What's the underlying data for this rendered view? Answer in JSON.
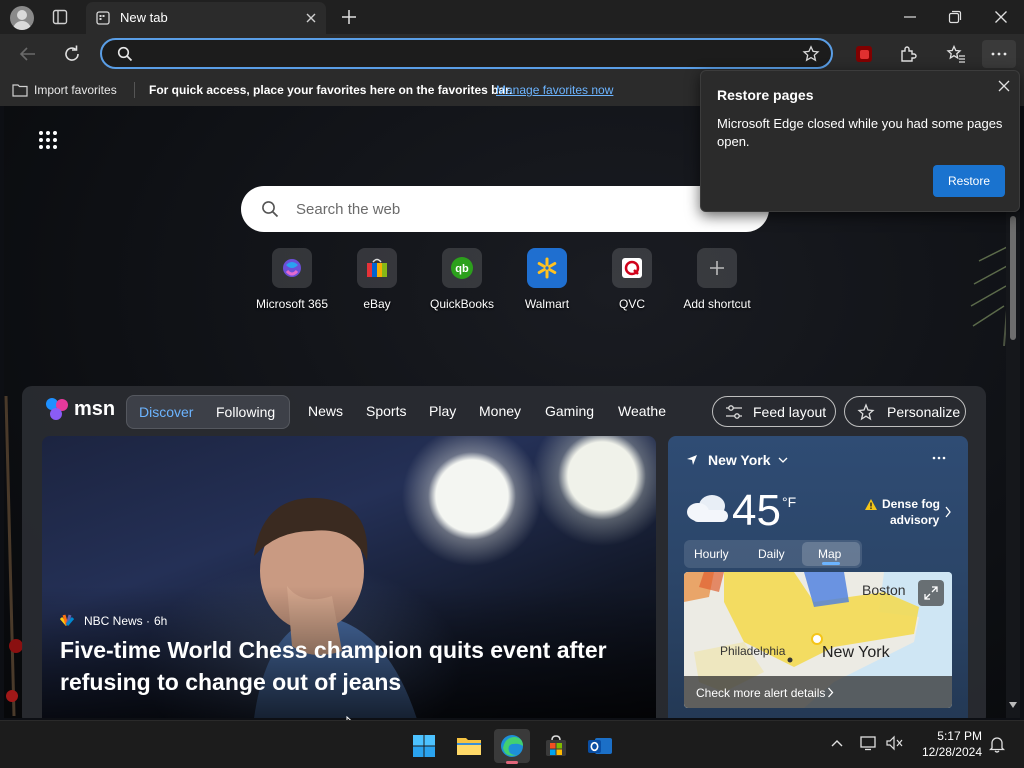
{
  "browser": {
    "tab_title": "New tab",
    "address_value": "",
    "favorites_bar": {
      "import_label": "Import favorites",
      "message": "For quick access, place your favorites here on the favorites bar.",
      "manage_link": "Manage favorites now"
    }
  },
  "newtab": {
    "search_placeholder": "Search the web",
    "shortcuts": [
      {
        "label": "Microsoft 365",
        "icon": "microsoft-365-icon"
      },
      {
        "label": "eBay",
        "icon": "ebay-icon"
      },
      {
        "label": "QuickBooks",
        "icon": "quickbooks-icon"
      },
      {
        "label": "Walmart",
        "icon": "walmart-icon"
      },
      {
        "label": "QVC",
        "icon": "qvc-icon"
      },
      {
        "label": "Add shortcut",
        "icon": "plus-icon"
      }
    ]
  },
  "msn": {
    "logo": "msn",
    "nav": {
      "discover": "Discover",
      "following": "Following",
      "news": "News",
      "sports": "Sports",
      "play": "Play",
      "money": "Money",
      "gaming": "Gaming",
      "weather": "Weathe"
    },
    "feed_layout": "Feed layout",
    "personalize": "Personalize",
    "hero": {
      "source": "NBC News",
      "age": "6h",
      "headline": "Five-time World Chess champion quits event after refusing to change out of jeans"
    },
    "weather": {
      "location": "New York",
      "temp": "45",
      "unit": "°F",
      "alert_line1": "Dense fog",
      "alert_line2": "advisory",
      "tabs": {
        "hourly": "Hourly",
        "daily": "Daily",
        "map": "Map"
      },
      "map_labels": {
        "boston": "Boston",
        "philadelphia": "Philadelphia",
        "new_york": "New York"
      },
      "alert_details": "Check more alert details"
    }
  },
  "restore_popup": {
    "title": "Restore pages",
    "message": "Microsoft Edge closed while you had some pages open.",
    "button": "Restore"
  },
  "taskbar": {
    "time": "5:17 PM",
    "date": "12/28/2024"
  },
  "colors": {
    "accent": "#1a73cf",
    "link": "#6cb4ff",
    "address_border": "#5a9ee6"
  }
}
